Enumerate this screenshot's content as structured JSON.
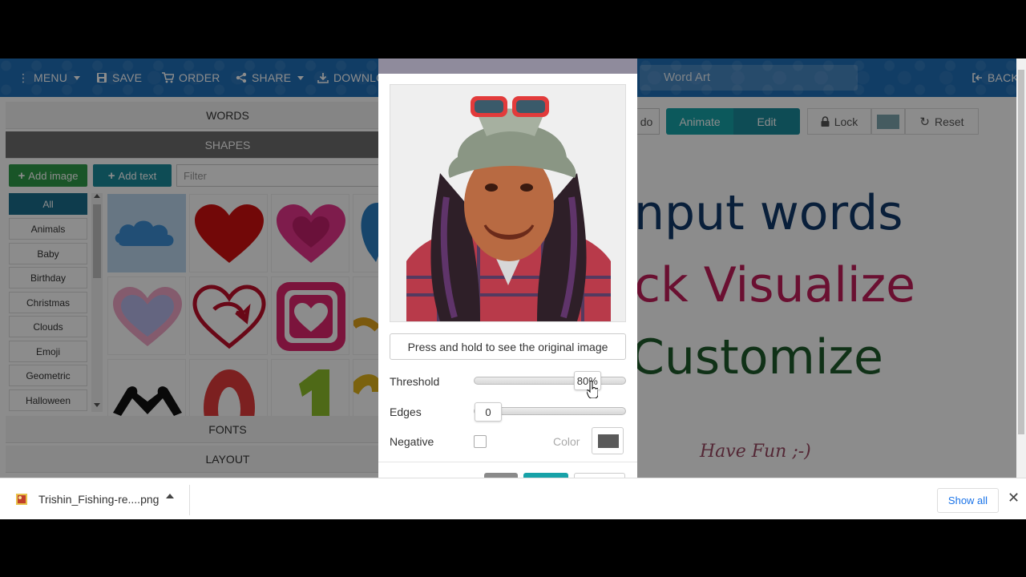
{
  "nav": {
    "menu": "MENU",
    "save": "SAVE",
    "order": "ORDER",
    "share": "SHARE",
    "download": "DOWNLO",
    "title_placeholder": "Word Art",
    "back": "BACK"
  },
  "left": {
    "sections": {
      "words": "WORDS",
      "shapes": "SHAPES",
      "fonts": "FONTS",
      "layout": "LAYOUT"
    },
    "add_image": "Add image",
    "add_text": "Add text",
    "filter_placeholder": "Filter",
    "categories": [
      "All",
      "Animals",
      "Baby",
      "Birthday",
      "Christmas",
      "Clouds",
      "Emoji",
      "Geometric",
      "Halloween"
    ],
    "selected_category": "All"
  },
  "toolbar": {
    "undo_partial": "do",
    "animate": "Animate",
    "edit": "Edit",
    "lock": "Lock",
    "reset": "Reset",
    "swatch_color": "#7fa6b0"
  },
  "canvas": {
    "lines": [
      {
        "text": "nput words",
        "color": "#123a6b"
      },
      {
        "text": "ck Visualize",
        "color": "#c21e5a"
      },
      {
        "text": "Customize",
        "color": "#1e5a2a"
      },
      {
        "text": "Have Fun ;-)",
        "color": "#9a4a63"
      }
    ]
  },
  "modal": {
    "press_button": "Press and hold to see the original image",
    "threshold_label": "Threshold",
    "threshold_value": "80%",
    "threshold_fraction": 0.8,
    "edges_label": "Edges",
    "edges_value": "0",
    "negative_label": "Negative",
    "negative_checked": false,
    "color_label": "Color",
    "color_value": "#5a5a5a"
  },
  "download_bar": {
    "filename": "Trishin_Fishing-re....png",
    "show_all": "Show all"
  },
  "colors": {
    "nav_bg": "#1f6fb8",
    "accent_green": "#2e9b4a",
    "accent_teal": "#1a8b9b"
  }
}
